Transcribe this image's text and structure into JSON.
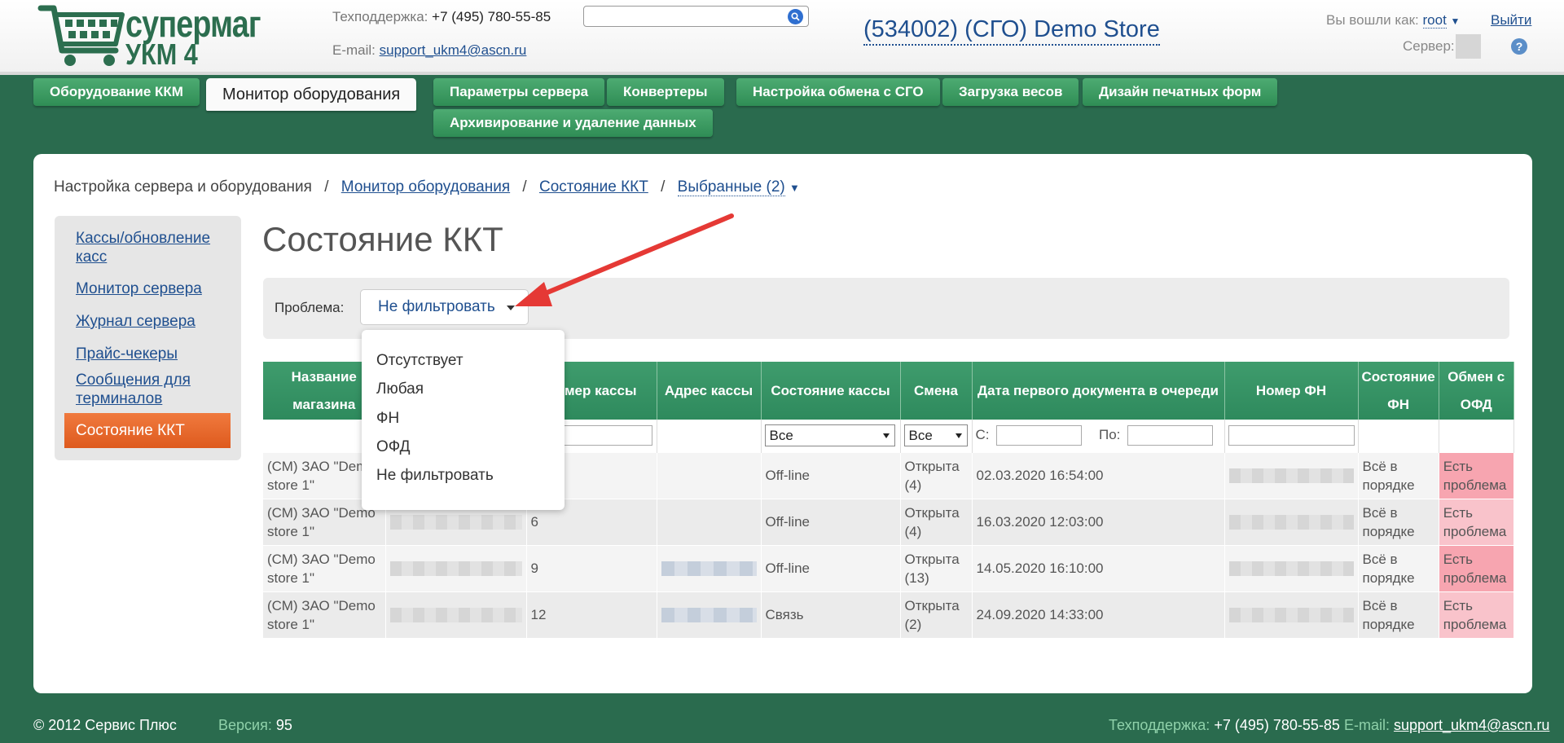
{
  "header": {
    "logo_line1": "супермаг",
    "logo_line2": "УКМ 4",
    "support_label": "Техподдержка:",
    "support_phone": "+7 (495) 780-55-85",
    "email_label": "E-mail:",
    "email": "support_ukm4@ascn.ru",
    "search_value": "",
    "store_name": "(534002) (СГО) Demo Store",
    "logged_in_label": "Вы вошли как:",
    "user": "root",
    "logout": "Выйти",
    "server_label": "Сервер:",
    "help": "?"
  },
  "nav": {
    "items": [
      "Оборудование ККМ",
      "Монитор оборудования",
      "Параметры сервера",
      "Конвертеры",
      "Настройка обмена с СГО",
      "Загрузка весов",
      "Дизайн печатных форм",
      "Архивирование и удаление данных"
    ],
    "active_index": 1
  },
  "breadcrumb": {
    "root": "Настройка сервера и оборудования",
    "monitor": "Монитор оборудования",
    "kkt": "Состояние ККТ",
    "selected": "Выбранные (2)",
    "separator": "/"
  },
  "sidebar": {
    "items": [
      "Кассы/обновление касс",
      "Монитор сервера",
      "Журнал сервера",
      "Прайс-чекеры",
      "Сообщения для терминалов",
      "Состояние ККТ"
    ]
  },
  "page_title": "Состояние ККТ",
  "filter": {
    "label": "Проблема:",
    "selected": "Не фильтровать",
    "options": [
      "Отсутствует",
      "Любая",
      "ФН",
      "ОФД",
      "Не фильтровать"
    ]
  },
  "table": {
    "headers": [
      "Название магазина",
      "",
      "Номер кассы",
      "Адрес кассы",
      "Состояние кассы",
      "Смена",
      "Дата первого документа в очереди",
      "Номер ФН",
      "Состояние ФН",
      "Обмен с ОФД"
    ],
    "filters": {
      "state": "Все",
      "shift": "Все",
      "from_label": "С:",
      "to_label": "По:"
    },
    "rows": [
      {
        "store": "(СМ) ЗАО \"Demo store 1\"",
        "pos": "",
        "addr": "",
        "state": "Off-line",
        "shift": "Открыта (4)",
        "date": "02.03.2020 16:54:00",
        "fn_state": "Всё в порядке",
        "ofd": "Есть проблема"
      },
      {
        "store": "(СМ) ЗАО \"Demo store 1\"",
        "pos": "6",
        "addr": "",
        "state": "Off-line",
        "shift": "Открыта (4)",
        "date": "16.03.2020 12:03:00",
        "fn_state": "Всё в порядке",
        "ofd": "Есть проблема"
      },
      {
        "store": "(СМ) ЗАО \"Demo store 1\"",
        "pos": "9",
        "addr": "",
        "state": "Off-line",
        "shift": "Открыта (13)",
        "date": "14.05.2020 16:10:00",
        "fn_state": "Всё в порядке",
        "ofd": "Есть проблема"
      },
      {
        "store": "(СМ) ЗАО \"Demo store 1\"",
        "pos": "12",
        "addr": "",
        "state": "Связь",
        "shift": "Открыта (2)",
        "date": "24.09.2020 14:33:00",
        "fn_state": "Всё в порядке",
        "ofd": "Есть проблема"
      }
    ]
  },
  "footer": {
    "copyright": "© 2012 Сервис Плюс",
    "version_label": "Версия:",
    "version": "95",
    "support_label": "Техподдержка:",
    "support_phone": "+7 (495) 780-55-85",
    "email_label": "E-mail:",
    "email": "support_ukm4@ascn.ru"
  },
  "colors": {
    "background": "#2a6b4e",
    "nav_green": "#3a9a63",
    "sidebar_active": "#e8692d",
    "problem": "#f7a5b0",
    "link": "#1f4f8f"
  }
}
